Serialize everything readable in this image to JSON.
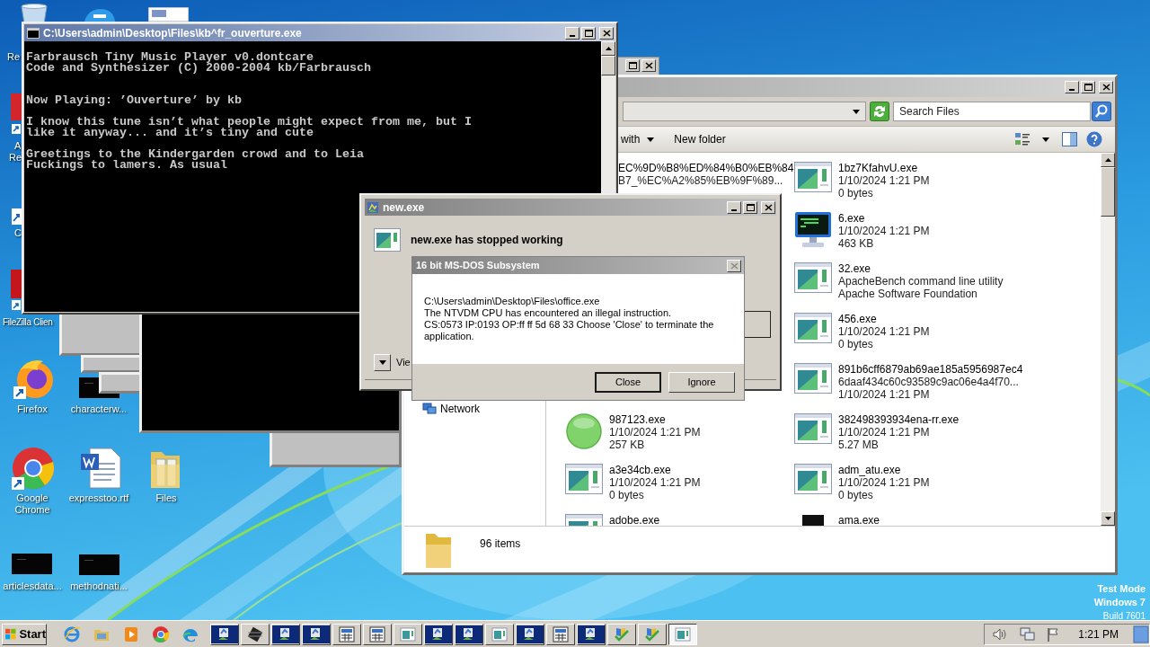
{
  "desktop_icons": [
    {
      "kind": "recycle_bin",
      "lines": [
        "Re"
      ]
    },
    {
      "kind": "reader",
      "lines": [
        "A",
        "Re"
      ]
    },
    {
      "kind": "shortcut",
      "lines": [
        "C"
      ]
    },
    {
      "kind": "filezilla",
      "lines": [
        "FileZilla Clien"
      ]
    },
    {
      "kind": "firefox",
      "lines": [
        "Firefox"
      ]
    },
    {
      "kind": "chrome",
      "lines": [
        "Google",
        "Chrome"
      ]
    },
    {
      "kind": "thumbnail",
      "lines": [
        "articlesdata..."
      ]
    },
    {
      "kind": "edge"
    },
    {
      "kind": "thumbnail",
      "lines": [
        "characterw..."
      ]
    },
    {
      "kind": "word",
      "lines": [
        "expresstoo.rtf"
      ]
    },
    {
      "kind": "thumbnail",
      "lines": [
        "methodnati..."
      ]
    },
    {
      "kind": "document"
    },
    {
      "kind": "folder",
      "lines": [
        "Files"
      ]
    }
  ],
  "explorer_window": {
    "toolbar": {
      "open_with": "with",
      "new_folder": "New folder"
    },
    "search": {
      "placeholder": "Search Files"
    },
    "navigation": [
      {
        "label": "Network"
      }
    ],
    "file_columns": [
      [
        {
          "name": "EC%9D%B8%ED%84%B0%EB%84",
          "details": [
            "B7_%EC%A2%85%EB%9F%89..."
          ]
        },
        {
          "kind": "green_orb",
          "name": "987123.exe",
          "details": [
            "1/10/2024 1:21 PM",
            "257 KB"
          ]
        },
        {
          "kind": "program",
          "name": "a3e34cb.exe",
          "details": [
            "1/10/2024 1:21 PM",
            "0 bytes"
          ]
        },
        {
          "kind": "program",
          "name": "adobe.exe"
        }
      ],
      [
        {
          "kind": "program",
          "name": "1bz7KfahvU.exe",
          "details": [
            "1/10/2024 1:21 PM",
            "0 bytes"
          ]
        },
        {
          "kind": "monitor",
          "name": "6.exe",
          "details": [
            "1/10/2024 1:21 PM",
            "463 KB"
          ]
        },
        {
          "kind": "program",
          "name": "32.exe",
          "details": [
            "ApacheBench command line utility",
            "Apache Software Foundation"
          ]
        },
        {
          "kind": "program",
          "name": "456.exe",
          "details": [
            "1/10/2024 1:21 PM",
            "0 bytes"
          ]
        },
        {
          "kind": "program",
          "name": "891b6cff6879ab69ae185a5956987ec4",
          "details": [
            "6daaf434c60c93589c9ac06e4a4f70...",
            "1/10/2024 1:21 PM"
          ]
        },
        {
          "kind": "program",
          "name": "382498393934ena-rr.exe",
          "details": [
            "1/10/2024 1:21 PM",
            "5.27 MB"
          ]
        },
        {
          "kind": "program",
          "name": "adm_atu.exe",
          "details": [
            "1/10/2024 1:21 PM",
            "0 bytes"
          ]
        },
        {
          "kind": "black_box",
          "name": "ama.exe"
        }
      ]
    ],
    "status": "96 items"
  },
  "console_window": {
    "title": "C:\\Users\\admin\\Desktop\\Files\\kb^fr_ouverture.exe",
    "paragraphs": [
      [
        "Farbrausch Tiny Music Player v0.dontcare",
        "Code and Synthesizer (C) 2000-2004 kb/Farbrausch"
      ],
      [
        "Now Playing: ’Ouverture’ by kb"
      ],
      [
        "I know this tune isn’t what people might expect from me, but I",
        "like it anyway... and it’s tiny and cute"
      ],
      [
        "Greetings to the Kindergarden crowd and to Leia",
        "Fuckings to lamers. As usual"
      ]
    ]
  },
  "error_window": {
    "title": "new.exe",
    "message": "new.exe has stopped working",
    "details_toggle": "Vie"
  },
  "msdos_dialog": {
    "title": "16 bit MS-DOS Subsystem",
    "lines": [
      "C:\\Users\\admin\\Desktop\\Files\\office.exe",
      "The NTVDM CPU has encountered an illegal instruction.",
      "CS:0573 IP:0193 OP:ff ff 5d 68 33 Choose 'Close' to terminate the application."
    ],
    "buttons": [
      {
        "label": "Close",
        "default": true
      },
      {
        "label": "Ignore",
        "default": false
      }
    ]
  },
  "taskbar": {
    "start": "Start",
    "quick_launch": [
      {
        "kind": "ie"
      },
      {
        "kind": "explorer"
      },
      {
        "kind": "media"
      },
      {
        "kind": "chrome"
      },
      {
        "kind": "edge"
      }
    ],
    "tasks": [
      {
        "kind": "setup",
        "selected": false
      },
      {
        "kind": "chip",
        "selected": false
      },
      {
        "kind": "setup",
        "selected": false
      },
      {
        "kind": "setup",
        "selected": false
      },
      {
        "kind": "app",
        "selected": false
      },
      {
        "kind": "app",
        "selected": false
      },
      {
        "kind": "window",
        "selected": false
      },
      {
        "kind": "setup",
        "selected": false
      },
      {
        "kind": "setup",
        "selected": false
      },
      {
        "kind": "window",
        "selected": false
      },
      {
        "kind": "setup",
        "selected": false
      },
      {
        "kind": "app",
        "selected": false
      },
      {
        "kind": "setup",
        "selected": false
      },
      {
        "kind": "check",
        "selected": false
      },
      {
        "kind": "check",
        "selected": false
      },
      {
        "kind": "window",
        "selected": true
      }
    ],
    "clock": "1:21 PM"
  },
  "system_notice": [
    "Test Mode",
    "Windows 7",
    "Build 7601"
  ]
}
